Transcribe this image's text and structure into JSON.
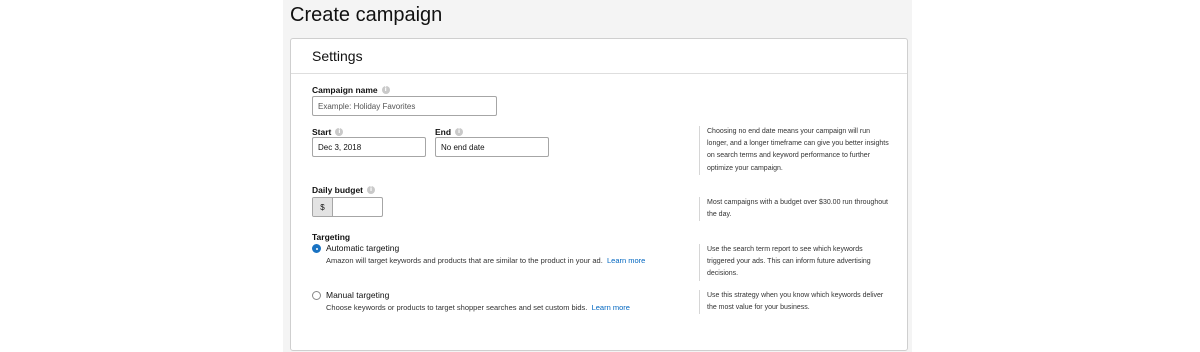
{
  "page": {
    "title": "Create campaign"
  },
  "settings": {
    "title": "Settings",
    "campaign_name": {
      "label": "Campaign name",
      "placeholder": "Example: Holiday Favorites"
    },
    "start": {
      "label": "Start",
      "value": "Dec 3, 2018"
    },
    "end": {
      "label": "End",
      "value": "No end date"
    },
    "end_help": "Choosing no end date means your campaign will run longer, and a longer timeframe can give you better insights on search terms and keyword performance to further optimize your campaign.",
    "daily_budget": {
      "label": "Daily budget",
      "currency_symbol": "$",
      "value": ""
    },
    "budget_help": "Most campaigns with a budget over $30.00 run throughout the day.",
    "targeting": {
      "label": "Targeting",
      "automatic": {
        "title": "Automatic targeting",
        "description": "Amazon will target keywords and products that are similar to the product in your ad.",
        "link": "Learn more",
        "selected": true,
        "help": "Use the search term report to see which keywords triggered your ads. This can inform future advertising decisions."
      },
      "manual": {
        "title": "Manual targeting",
        "description": "Choose keywords or products to target shopper searches and set custom bids.",
        "link": "Learn more",
        "selected": false,
        "help": "Use this strategy when you know which keywords deliver the most value for your business."
      }
    }
  },
  "icons": {
    "info": "info-icon",
    "radio_selected": "radio-selected-icon",
    "radio_unselected": "radio-unselected-icon"
  },
  "colors": {
    "link": "#0066c0",
    "radio_selected": "#1a73c2",
    "border": "#cfcfcf",
    "background": "#f4f4f4"
  }
}
